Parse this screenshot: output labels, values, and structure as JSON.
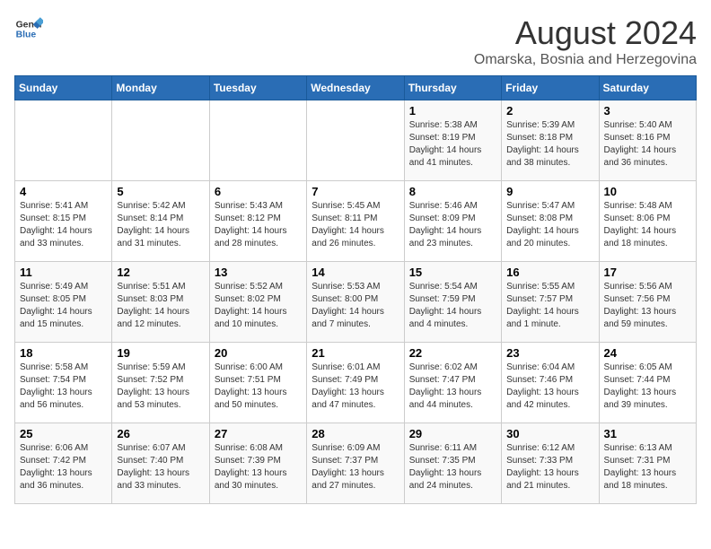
{
  "logo": {
    "text_general": "General",
    "text_blue": "Blue"
  },
  "title": {
    "month_year": "August 2024",
    "location": "Omarska, Bosnia and Herzegovina"
  },
  "headers": [
    "Sunday",
    "Monday",
    "Tuesday",
    "Wednesday",
    "Thursday",
    "Friday",
    "Saturday"
  ],
  "weeks": [
    [
      {
        "day": "",
        "info": ""
      },
      {
        "day": "",
        "info": ""
      },
      {
        "day": "",
        "info": ""
      },
      {
        "day": "",
        "info": ""
      },
      {
        "day": "1",
        "info": "Sunrise: 5:38 AM\nSunset: 8:19 PM\nDaylight: 14 hours\nand 41 minutes."
      },
      {
        "day": "2",
        "info": "Sunrise: 5:39 AM\nSunset: 8:18 PM\nDaylight: 14 hours\nand 38 minutes."
      },
      {
        "day": "3",
        "info": "Sunrise: 5:40 AM\nSunset: 8:16 PM\nDaylight: 14 hours\nand 36 minutes."
      }
    ],
    [
      {
        "day": "4",
        "info": "Sunrise: 5:41 AM\nSunset: 8:15 PM\nDaylight: 14 hours\nand 33 minutes."
      },
      {
        "day": "5",
        "info": "Sunrise: 5:42 AM\nSunset: 8:14 PM\nDaylight: 14 hours\nand 31 minutes."
      },
      {
        "day": "6",
        "info": "Sunrise: 5:43 AM\nSunset: 8:12 PM\nDaylight: 14 hours\nand 28 minutes."
      },
      {
        "day": "7",
        "info": "Sunrise: 5:45 AM\nSunset: 8:11 PM\nDaylight: 14 hours\nand 26 minutes."
      },
      {
        "day": "8",
        "info": "Sunrise: 5:46 AM\nSunset: 8:09 PM\nDaylight: 14 hours\nand 23 minutes."
      },
      {
        "day": "9",
        "info": "Sunrise: 5:47 AM\nSunset: 8:08 PM\nDaylight: 14 hours\nand 20 minutes."
      },
      {
        "day": "10",
        "info": "Sunrise: 5:48 AM\nSunset: 8:06 PM\nDaylight: 14 hours\nand 18 minutes."
      }
    ],
    [
      {
        "day": "11",
        "info": "Sunrise: 5:49 AM\nSunset: 8:05 PM\nDaylight: 14 hours\nand 15 minutes."
      },
      {
        "day": "12",
        "info": "Sunrise: 5:51 AM\nSunset: 8:03 PM\nDaylight: 14 hours\nand 12 minutes."
      },
      {
        "day": "13",
        "info": "Sunrise: 5:52 AM\nSunset: 8:02 PM\nDaylight: 14 hours\nand 10 minutes."
      },
      {
        "day": "14",
        "info": "Sunrise: 5:53 AM\nSunset: 8:00 PM\nDaylight: 14 hours\nand 7 minutes."
      },
      {
        "day": "15",
        "info": "Sunrise: 5:54 AM\nSunset: 7:59 PM\nDaylight: 14 hours\nand 4 minutes."
      },
      {
        "day": "16",
        "info": "Sunrise: 5:55 AM\nSunset: 7:57 PM\nDaylight: 14 hours\nand 1 minute."
      },
      {
        "day": "17",
        "info": "Sunrise: 5:56 AM\nSunset: 7:56 PM\nDaylight: 13 hours\nand 59 minutes."
      }
    ],
    [
      {
        "day": "18",
        "info": "Sunrise: 5:58 AM\nSunset: 7:54 PM\nDaylight: 13 hours\nand 56 minutes."
      },
      {
        "day": "19",
        "info": "Sunrise: 5:59 AM\nSunset: 7:52 PM\nDaylight: 13 hours\nand 53 minutes."
      },
      {
        "day": "20",
        "info": "Sunrise: 6:00 AM\nSunset: 7:51 PM\nDaylight: 13 hours\nand 50 minutes."
      },
      {
        "day": "21",
        "info": "Sunrise: 6:01 AM\nSunset: 7:49 PM\nDaylight: 13 hours\nand 47 minutes."
      },
      {
        "day": "22",
        "info": "Sunrise: 6:02 AM\nSunset: 7:47 PM\nDaylight: 13 hours\nand 44 minutes."
      },
      {
        "day": "23",
        "info": "Sunrise: 6:04 AM\nSunset: 7:46 PM\nDaylight: 13 hours\nand 42 minutes."
      },
      {
        "day": "24",
        "info": "Sunrise: 6:05 AM\nSunset: 7:44 PM\nDaylight: 13 hours\nand 39 minutes."
      }
    ],
    [
      {
        "day": "25",
        "info": "Sunrise: 6:06 AM\nSunset: 7:42 PM\nDaylight: 13 hours\nand 36 minutes."
      },
      {
        "day": "26",
        "info": "Sunrise: 6:07 AM\nSunset: 7:40 PM\nDaylight: 13 hours\nand 33 minutes."
      },
      {
        "day": "27",
        "info": "Sunrise: 6:08 AM\nSunset: 7:39 PM\nDaylight: 13 hours\nand 30 minutes."
      },
      {
        "day": "28",
        "info": "Sunrise: 6:09 AM\nSunset: 7:37 PM\nDaylight: 13 hours\nand 27 minutes."
      },
      {
        "day": "29",
        "info": "Sunrise: 6:11 AM\nSunset: 7:35 PM\nDaylight: 13 hours\nand 24 minutes."
      },
      {
        "day": "30",
        "info": "Sunrise: 6:12 AM\nSunset: 7:33 PM\nDaylight: 13 hours\nand 21 minutes."
      },
      {
        "day": "31",
        "info": "Sunrise: 6:13 AM\nSunset: 7:31 PM\nDaylight: 13 hours\nand 18 minutes."
      }
    ]
  ]
}
